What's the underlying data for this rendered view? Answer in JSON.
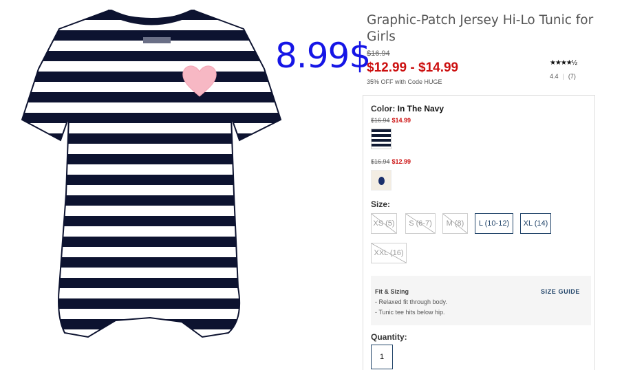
{
  "handwritten_price": "8.99$",
  "product": {
    "title": "Graphic-Patch Jersey Hi-Lo Tunic for Girls",
    "original_price": "$16.94",
    "sale_price": "$12.99 - $14.99",
    "promo": "35% OFF with Code HUGE",
    "rating": {
      "stars": "★★★★½",
      "value": "4.4",
      "count": "(7)"
    },
    "image_icon": "striped-tunic-image"
  },
  "color": {
    "label": "Color:",
    "selected": "In The Navy",
    "options": [
      {
        "original": "$16.94",
        "sale": "$14.99",
        "swatch_color": "#101a33"
      },
      {
        "original": "$16.94",
        "sale": "$12.99",
        "swatch_color": "#1a2f6b"
      }
    ]
  },
  "size": {
    "label": "Size:",
    "options": [
      {
        "label": "XS (5)",
        "available": false
      },
      {
        "label": "S (6-7)",
        "available": false
      },
      {
        "label": "M (8)",
        "available": false
      },
      {
        "label": "L (10-12)",
        "available": true
      },
      {
        "label": "XL (14)",
        "available": true
      },
      {
        "label": "XXL (16)",
        "available": false
      }
    ]
  },
  "fit": {
    "title": "Fit & Sizing",
    "guide_link": "SIZE GUIDE",
    "bullets": [
      "- Relaxed fit through body.",
      "- Tunic tee hits below hip."
    ]
  },
  "quantity": {
    "label": "Quantity:",
    "value": "1"
  },
  "colors": {
    "sale_red": "#cc1010",
    "accent_navy": "#22456a",
    "handwritten_blue": "#1515e6"
  }
}
